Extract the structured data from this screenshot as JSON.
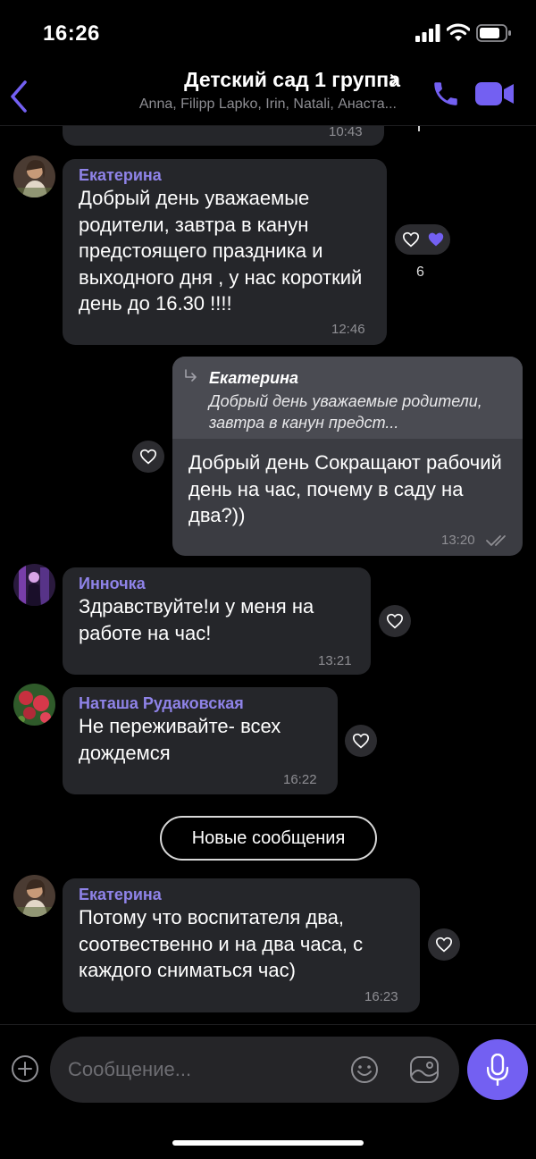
{
  "status_bar": {
    "time": "16:26"
  },
  "header": {
    "title": "Детский сад 1 группа",
    "members": "Anna, Filipp Lapko, Irin, Natali, Анаста..."
  },
  "messages": [
    {
      "time": "10:43"
    },
    {
      "sender": "Екатерина",
      "text": "Добрый день уважаемые родители, завтра в канун предстоящего праздника и выходного дня , у нас короткий день до 16.30 !!!!",
      "time": "12:46",
      "reaction_count": "6"
    },
    {
      "reply_name": "Екатерина",
      "reply_text": "Добрый день уважаемые родители, завтра в канун предст...",
      "text": "Добрый день Сокращают рабочий день на час, почему в саду на два?))",
      "time": "13:20"
    },
    {
      "sender": "Инночка",
      "text": "Здравствуйте!и у меня на работе на час!",
      "time": "13:21"
    },
    {
      "sender": "Наташа Рудаковская",
      "text": "Не переживайте- всех дождемся",
      "time": "16:22"
    },
    {
      "sender": "Екатерина",
      "text": "Потому что воспитателя два, соотвественно и на два часа, с каждого сниматься час)",
      "time": "16:23"
    }
  ],
  "new_messages_label": "Новые сообщения",
  "composer": {
    "placeholder": "Сообщение..."
  },
  "colors": {
    "accent": "#7360f2",
    "sender": "#8f83e8",
    "bubble_in": "#25262a",
    "bubble_out": "#3b3c42"
  },
  "icons": [
    "signal-icon",
    "wifi-icon",
    "battery-icon",
    "back-icon",
    "chevron-right-icon",
    "phone-icon",
    "video-icon",
    "heart-icon",
    "reply-arrow-icon",
    "read-check-icon",
    "plus-icon",
    "emoji-icon",
    "sticker-icon",
    "mic-icon"
  ]
}
